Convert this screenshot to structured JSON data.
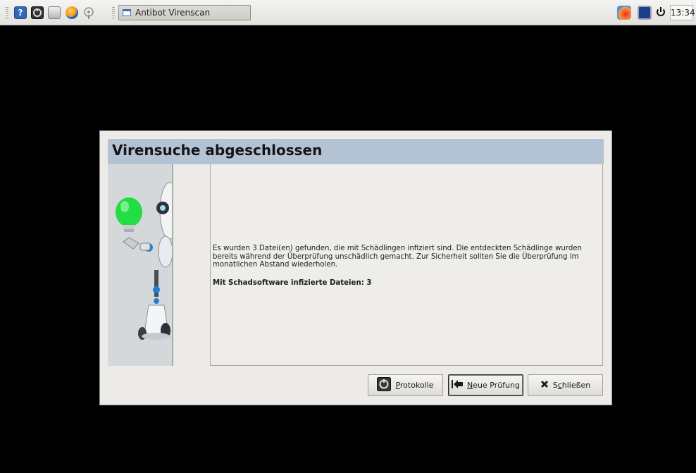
{
  "taskbar": {
    "task_title": "Antibot Virenscan",
    "clock": "13:34",
    "launcher_icons": [
      "help-icon",
      "antibot-icon",
      "show-desktop-icon",
      "firefox-icon",
      "network-icon"
    ],
    "tray_icons": [
      "security-update-icon",
      "monitor-icon",
      "power-icon"
    ]
  },
  "dialog": {
    "title": "Virensuche abgeschlossen",
    "message": "Es wurden 3 Datei(en) gefunden, die mit Schädlingen infiziert sind. Die entdeckten Schädlinge wurden bereits während der Überprüfung unschädlich gemacht. Zur Sicherheit sollten Sie die Überprüfung im monatlichen Abstand wiederholen.",
    "result_label": "Mit Schadsoftware infizierte Dateien:",
    "result_count": "3",
    "buttons": {
      "logs_mnemonic": "P",
      "logs_rest": "rotokolle",
      "new_scan_mnemonic": "N",
      "new_scan_rest": "eue Prüfung",
      "close_prefix": "S",
      "close_mnemonic": "c",
      "close_rest": "hließen"
    }
  },
  "colors": {
    "header_bg": "#b3c3d3",
    "dialog_bg": "#ecebe8",
    "desktop_bg": "#000000",
    "bulb_green": "#22dd44"
  }
}
